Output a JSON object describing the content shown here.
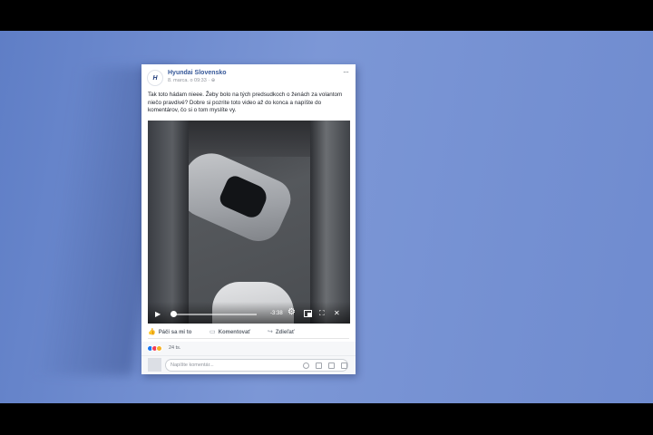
{
  "post": {
    "page_name": "Hyundai Slovensko",
    "timestamp": "8. marca. o 09:33 · ",
    "privacy_icon": "globe-icon",
    "logo_text": "H",
    "more_icon": "···",
    "text": "Tak toto hádam nieee. Žeby bolo na tých predsudkoch o ženách za volantom niečo pravdivé? Dobre si pozrite toto video až do konca a napíšte do komentárov, čo si o tom myslíte vy."
  },
  "video": {
    "time_remaining": "-3:38",
    "progress_fraction": 0.0
  },
  "actions": {
    "like": "Páči sa mi to",
    "comment": "Komentovať",
    "share": "Zdieľať"
  },
  "reactions": {
    "count": "24 ts."
  },
  "comment": {
    "placeholder": "Napíšte komentár..."
  },
  "colors": {
    "background": "#6f8bcf",
    "link": "#365899"
  }
}
